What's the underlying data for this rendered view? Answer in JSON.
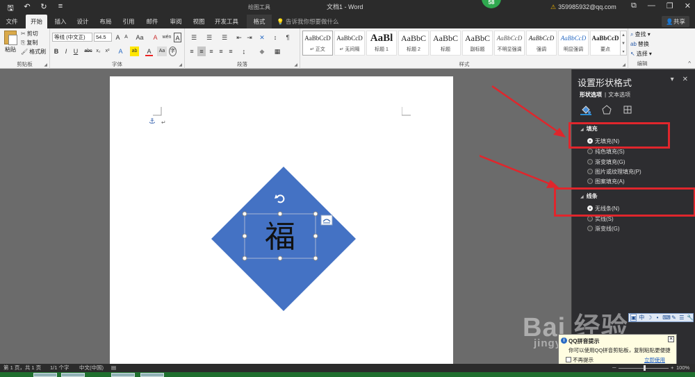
{
  "titlebar": {
    "qat_icons": [
      "save-icon",
      "undo-icon",
      "redo-icon",
      "customize-icon"
    ],
    "qat_glyphs": [
      "🖫",
      "↶",
      "↻",
      "≡"
    ],
    "context_tools": "绘图工具",
    "doc_title": "文档1 - Word",
    "badge": "58",
    "account": "359985932@qq.com",
    "warn_glyph": "⚠",
    "window_controls": [
      "⧉",
      "—",
      "❐",
      "✕"
    ]
  },
  "tabs": [
    "文件",
    "开始",
    "插入",
    "设计",
    "布局",
    "引用",
    "邮件",
    "审阅",
    "视图",
    "开发工具",
    "格式"
  ],
  "active_tab": "开始",
  "tell_me": "告诉我你想要做什么",
  "share": "共享",
  "clipboard": {
    "paste": "粘贴",
    "cut": "剪切",
    "copy": "复制",
    "format_painter": "格式刷",
    "label": "剪贴板"
  },
  "font": {
    "family": "等线 (中文正)",
    "size": "54.5",
    "label": "字体",
    "grow": "A",
    "shrink": "A",
    "case": "Aa",
    "clear": "A",
    "wen": "wén",
    "border_char": "A",
    "row2": [
      "B",
      "I",
      "U",
      "abc",
      "x₂",
      "x²",
      "A",
      "ab",
      "A",
      "Aa",
      "A",
      "字"
    ]
  },
  "paragraph": {
    "label": "段落",
    "row1": [
      "☰",
      "☰",
      "☰",
      "⇤",
      "⇥",
      "✕",
      "↕",
      "¶"
    ],
    "row2": [
      "≡",
      "≡",
      "≡",
      "≡",
      "≡",
      "↨",
      "◆",
      "▦"
    ]
  },
  "styles": {
    "label": "样式",
    "items": [
      {
        "sample": "AaBbCcD",
        "name": "↵ 正文",
        "size": 9
      },
      {
        "sample": "AaBbCcD",
        "name": "↵ 无间隔",
        "size": 9
      },
      {
        "sample": "AaBl",
        "name": "标题 1",
        "size": 15
      },
      {
        "sample": "AaBbC",
        "name": "标题 2",
        "size": 12
      },
      {
        "sample": "AaBbC",
        "name": "标题",
        "size": 12
      },
      {
        "sample": "AaBbC",
        "name": "副标题",
        "size": 12
      },
      {
        "sample": "AaBbCcD",
        "name": "不明显强调",
        "size": 9
      },
      {
        "sample": "AaBbCcD",
        "name": "强调",
        "size": 9
      },
      {
        "sample": "AaBbCcD",
        "name": "明显强调",
        "size": 9
      },
      {
        "sample": "AaBbCcD",
        "name": "要点",
        "size": 9
      }
    ]
  },
  "editing": {
    "label": "编辑",
    "find": "查找",
    "replace": "替换",
    "select": "选择",
    "find_icon": "⌕",
    "replace_icon": "ab",
    "select_icon": "↖"
  },
  "document": {
    "shape_text": "福",
    "shape_color": "#4472c4",
    "anchor_glyph": "⚓",
    "para_glyph": "↵"
  },
  "pane": {
    "title": "设置形状格式",
    "tabs": [
      "形状选项",
      "文本选项"
    ],
    "fill_section": "填充",
    "fill_options": [
      "无填充(N)",
      "纯色填充(S)",
      "渐变填充(G)",
      "图片或纹理填充(P)",
      "图案填充(A)"
    ],
    "fill_selected": 0,
    "line_section": "线条",
    "line_options": [
      "无线条(N)",
      "实线(S)",
      "渐变线(G)"
    ],
    "line_selected": 0,
    "ctrl_glyphs": [
      "▾",
      "✕"
    ],
    "section_arrow": "◢"
  },
  "ime": [
    "中",
    "☽",
    "•",
    "⌨",
    "✎",
    "☰",
    "👕",
    "🔧"
  ],
  "watermark": {
    "big": "Bai  经验",
    "sub": "jingyan.baidu.com"
  },
  "qq_tip": {
    "title": "QQ拼音提示",
    "info_glyph": "i",
    "close_glyph": "✕",
    "body": "你可以使用QQ拼音剪贴板，复制粘贴更便捷",
    "dont_show": "不再提示",
    "use": "立即使用"
  },
  "status": {
    "page": "第 1 页，共 1 页",
    "words": "1/1 个字",
    "lang": "中文(中国)",
    "macro_icon": "▤",
    "zoom": "100%",
    "zoom_minus": "－",
    "zoom_plus": "+"
  },
  "annotation_color": "#e0262c"
}
